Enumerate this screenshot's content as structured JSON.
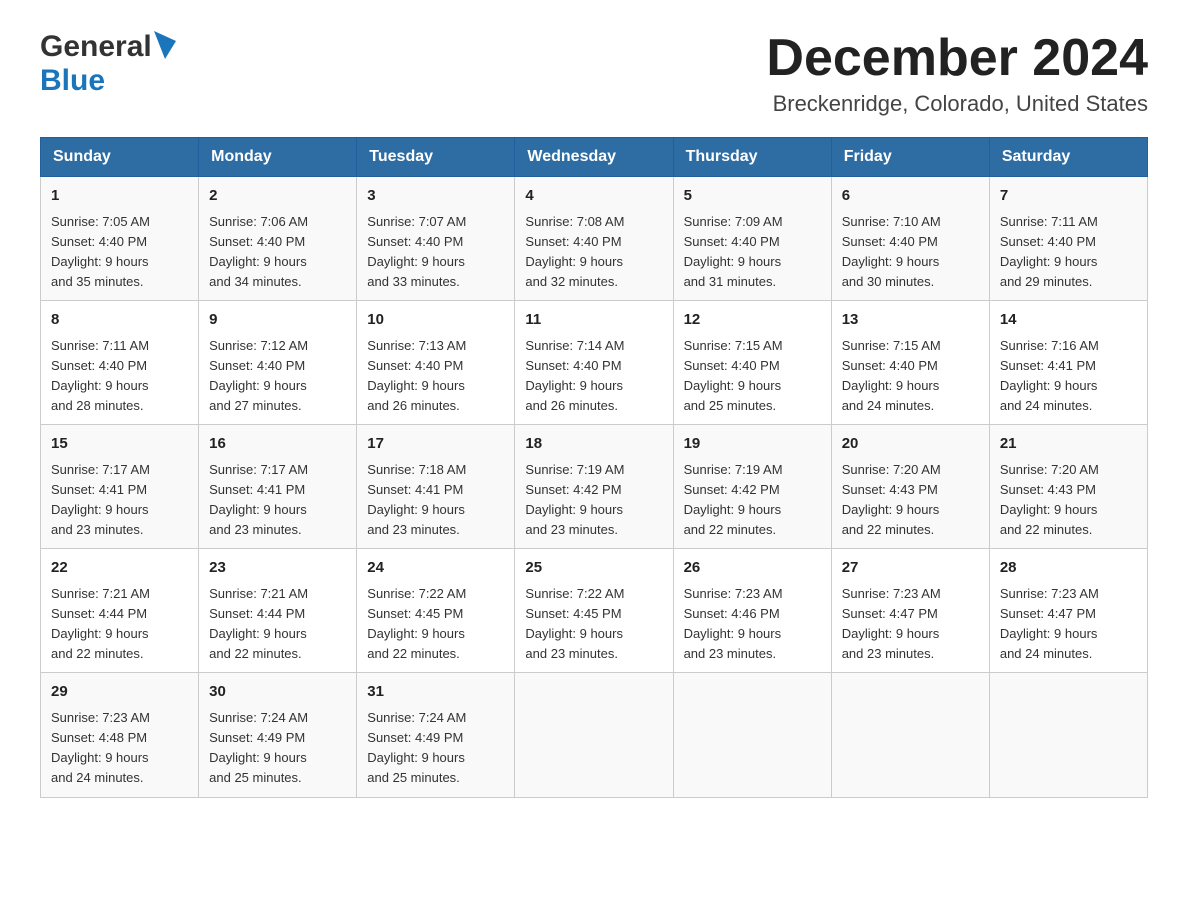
{
  "header": {
    "logo_general": "General",
    "logo_blue": "Blue",
    "month_title": "December 2024",
    "location": "Breckenridge, Colorado, United States"
  },
  "weekdays": [
    "Sunday",
    "Monday",
    "Tuesday",
    "Wednesday",
    "Thursday",
    "Friday",
    "Saturday"
  ],
  "weeks": [
    [
      {
        "day": "1",
        "sunrise": "Sunrise: 7:05 AM",
        "sunset": "Sunset: 4:40 PM",
        "daylight": "Daylight: 9 hours",
        "daylight2": "and 35 minutes."
      },
      {
        "day": "2",
        "sunrise": "Sunrise: 7:06 AM",
        "sunset": "Sunset: 4:40 PM",
        "daylight": "Daylight: 9 hours",
        "daylight2": "and 34 minutes."
      },
      {
        "day": "3",
        "sunrise": "Sunrise: 7:07 AM",
        "sunset": "Sunset: 4:40 PM",
        "daylight": "Daylight: 9 hours",
        "daylight2": "and 33 minutes."
      },
      {
        "day": "4",
        "sunrise": "Sunrise: 7:08 AM",
        "sunset": "Sunset: 4:40 PM",
        "daylight": "Daylight: 9 hours",
        "daylight2": "and 32 minutes."
      },
      {
        "day": "5",
        "sunrise": "Sunrise: 7:09 AM",
        "sunset": "Sunset: 4:40 PM",
        "daylight": "Daylight: 9 hours",
        "daylight2": "and 31 minutes."
      },
      {
        "day": "6",
        "sunrise": "Sunrise: 7:10 AM",
        "sunset": "Sunset: 4:40 PM",
        "daylight": "Daylight: 9 hours",
        "daylight2": "and 30 minutes."
      },
      {
        "day": "7",
        "sunrise": "Sunrise: 7:11 AM",
        "sunset": "Sunset: 4:40 PM",
        "daylight": "Daylight: 9 hours",
        "daylight2": "and 29 minutes."
      }
    ],
    [
      {
        "day": "8",
        "sunrise": "Sunrise: 7:11 AM",
        "sunset": "Sunset: 4:40 PM",
        "daylight": "Daylight: 9 hours",
        "daylight2": "and 28 minutes."
      },
      {
        "day": "9",
        "sunrise": "Sunrise: 7:12 AM",
        "sunset": "Sunset: 4:40 PM",
        "daylight": "Daylight: 9 hours",
        "daylight2": "and 27 minutes."
      },
      {
        "day": "10",
        "sunrise": "Sunrise: 7:13 AM",
        "sunset": "Sunset: 4:40 PM",
        "daylight": "Daylight: 9 hours",
        "daylight2": "and 26 minutes."
      },
      {
        "day": "11",
        "sunrise": "Sunrise: 7:14 AM",
        "sunset": "Sunset: 4:40 PM",
        "daylight": "Daylight: 9 hours",
        "daylight2": "and 26 minutes."
      },
      {
        "day": "12",
        "sunrise": "Sunrise: 7:15 AM",
        "sunset": "Sunset: 4:40 PM",
        "daylight": "Daylight: 9 hours",
        "daylight2": "and 25 minutes."
      },
      {
        "day": "13",
        "sunrise": "Sunrise: 7:15 AM",
        "sunset": "Sunset: 4:40 PM",
        "daylight": "Daylight: 9 hours",
        "daylight2": "and 24 minutes."
      },
      {
        "day": "14",
        "sunrise": "Sunrise: 7:16 AM",
        "sunset": "Sunset: 4:41 PM",
        "daylight": "Daylight: 9 hours",
        "daylight2": "and 24 minutes."
      }
    ],
    [
      {
        "day": "15",
        "sunrise": "Sunrise: 7:17 AM",
        "sunset": "Sunset: 4:41 PM",
        "daylight": "Daylight: 9 hours",
        "daylight2": "and 23 minutes."
      },
      {
        "day": "16",
        "sunrise": "Sunrise: 7:17 AM",
        "sunset": "Sunset: 4:41 PM",
        "daylight": "Daylight: 9 hours",
        "daylight2": "and 23 minutes."
      },
      {
        "day": "17",
        "sunrise": "Sunrise: 7:18 AM",
        "sunset": "Sunset: 4:41 PM",
        "daylight": "Daylight: 9 hours",
        "daylight2": "and 23 minutes."
      },
      {
        "day": "18",
        "sunrise": "Sunrise: 7:19 AM",
        "sunset": "Sunset: 4:42 PM",
        "daylight": "Daylight: 9 hours",
        "daylight2": "and 23 minutes."
      },
      {
        "day": "19",
        "sunrise": "Sunrise: 7:19 AM",
        "sunset": "Sunset: 4:42 PM",
        "daylight": "Daylight: 9 hours",
        "daylight2": "and 22 minutes."
      },
      {
        "day": "20",
        "sunrise": "Sunrise: 7:20 AM",
        "sunset": "Sunset: 4:43 PM",
        "daylight": "Daylight: 9 hours",
        "daylight2": "and 22 minutes."
      },
      {
        "day": "21",
        "sunrise": "Sunrise: 7:20 AM",
        "sunset": "Sunset: 4:43 PM",
        "daylight": "Daylight: 9 hours",
        "daylight2": "and 22 minutes."
      }
    ],
    [
      {
        "day": "22",
        "sunrise": "Sunrise: 7:21 AM",
        "sunset": "Sunset: 4:44 PM",
        "daylight": "Daylight: 9 hours",
        "daylight2": "and 22 minutes."
      },
      {
        "day": "23",
        "sunrise": "Sunrise: 7:21 AM",
        "sunset": "Sunset: 4:44 PM",
        "daylight": "Daylight: 9 hours",
        "daylight2": "and 22 minutes."
      },
      {
        "day": "24",
        "sunrise": "Sunrise: 7:22 AM",
        "sunset": "Sunset: 4:45 PM",
        "daylight": "Daylight: 9 hours",
        "daylight2": "and 22 minutes."
      },
      {
        "day": "25",
        "sunrise": "Sunrise: 7:22 AM",
        "sunset": "Sunset: 4:45 PM",
        "daylight": "Daylight: 9 hours",
        "daylight2": "and 23 minutes."
      },
      {
        "day": "26",
        "sunrise": "Sunrise: 7:23 AM",
        "sunset": "Sunset: 4:46 PM",
        "daylight": "Daylight: 9 hours",
        "daylight2": "and 23 minutes."
      },
      {
        "day": "27",
        "sunrise": "Sunrise: 7:23 AM",
        "sunset": "Sunset: 4:47 PM",
        "daylight": "Daylight: 9 hours",
        "daylight2": "and 23 minutes."
      },
      {
        "day": "28",
        "sunrise": "Sunrise: 7:23 AM",
        "sunset": "Sunset: 4:47 PM",
        "daylight": "Daylight: 9 hours",
        "daylight2": "and 24 minutes."
      }
    ],
    [
      {
        "day": "29",
        "sunrise": "Sunrise: 7:23 AM",
        "sunset": "Sunset: 4:48 PM",
        "daylight": "Daylight: 9 hours",
        "daylight2": "and 24 minutes."
      },
      {
        "day": "30",
        "sunrise": "Sunrise: 7:24 AM",
        "sunset": "Sunset: 4:49 PM",
        "daylight": "Daylight: 9 hours",
        "daylight2": "and 25 minutes."
      },
      {
        "day": "31",
        "sunrise": "Sunrise: 7:24 AM",
        "sunset": "Sunset: 4:49 PM",
        "daylight": "Daylight: 9 hours",
        "daylight2": "and 25 minutes."
      },
      null,
      null,
      null,
      null
    ]
  ]
}
